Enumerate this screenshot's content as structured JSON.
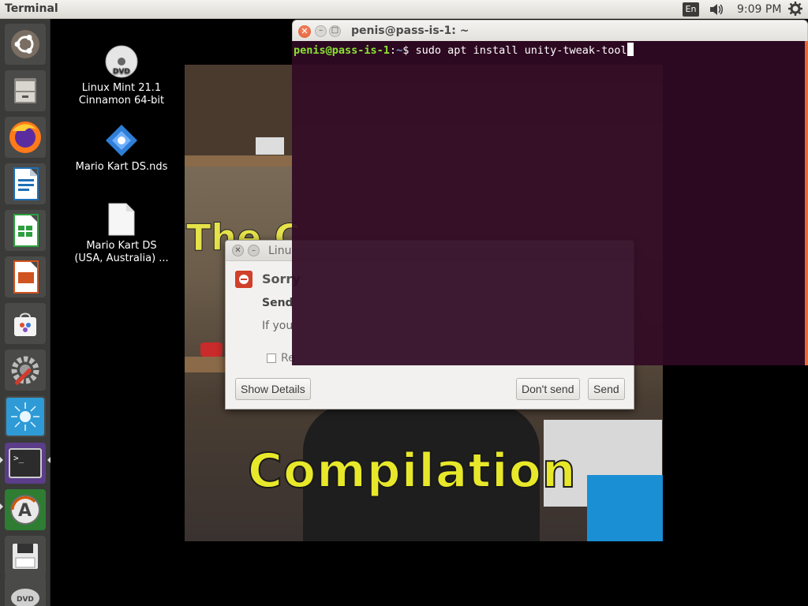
{
  "top_panel": {
    "app_title": "Terminal",
    "keyboard_layout": "En",
    "clock": "9:09 PM"
  },
  "launcher": {
    "items": [
      {
        "name": "ubuntu-dash",
        "icon": "ubuntu-logo-icon"
      },
      {
        "name": "files",
        "icon": "file-cabinet-icon"
      },
      {
        "name": "firefox",
        "icon": "firefox-icon"
      },
      {
        "name": "libreoffice-writer",
        "icon": "writer-icon"
      },
      {
        "name": "libreoffice-calc",
        "icon": "calc-icon"
      },
      {
        "name": "libreoffice-impress",
        "icon": "impress-icon"
      },
      {
        "name": "ubuntu-software",
        "icon": "software-bag-icon"
      },
      {
        "name": "system-settings",
        "icon": "settings-wrench-icon"
      },
      {
        "name": "unknown-app",
        "icon": "burst-icon"
      },
      {
        "name": "terminal",
        "icon": "terminal-icon"
      },
      {
        "name": "software-updater",
        "icon": "updater-icon"
      },
      {
        "name": "floppy-save",
        "icon": "floppy-icon"
      },
      {
        "name": "dvd",
        "icon": "dvd-icon"
      }
    ]
  },
  "desktop": {
    "icons": [
      {
        "label_line1": "Linux Mint 21.1",
        "label_line2": "Cinnamon 64-bit",
        "icon": "dvd-icon"
      },
      {
        "label_line1": "Mario Kart DS.nds",
        "label_line2": "",
        "icon": "rom-file-icon"
      },
      {
        "label_line1": "Mario Kart DS",
        "label_line2": "(USA, Australia) ...",
        "icon": "blank-file-icon"
      }
    ]
  },
  "video": {
    "partial_title": "The C",
    "caption": "Compilation"
  },
  "crash_dialog": {
    "title": "Linu",
    "heading": "Sorry",
    "subheading": "Send",
    "body": "If you",
    "checkbox_label": "Re",
    "buttons": {
      "show_details": "Show Details",
      "dont_send": "Don't send",
      "send": "Send"
    }
  },
  "terminal": {
    "title": "penis@pass-is-1: ~",
    "prompt_user": "penis@pass-is-1",
    "prompt_sep": ":",
    "prompt_path": "~",
    "prompt_symbol": "$ ",
    "command": "sudo apt install unity-tweak-tool",
    "colors": {
      "background": "#300a24",
      "prompt_user": "#8ae234",
      "prompt_path": "#729fcf",
      "accent": "#e86a3a"
    }
  }
}
